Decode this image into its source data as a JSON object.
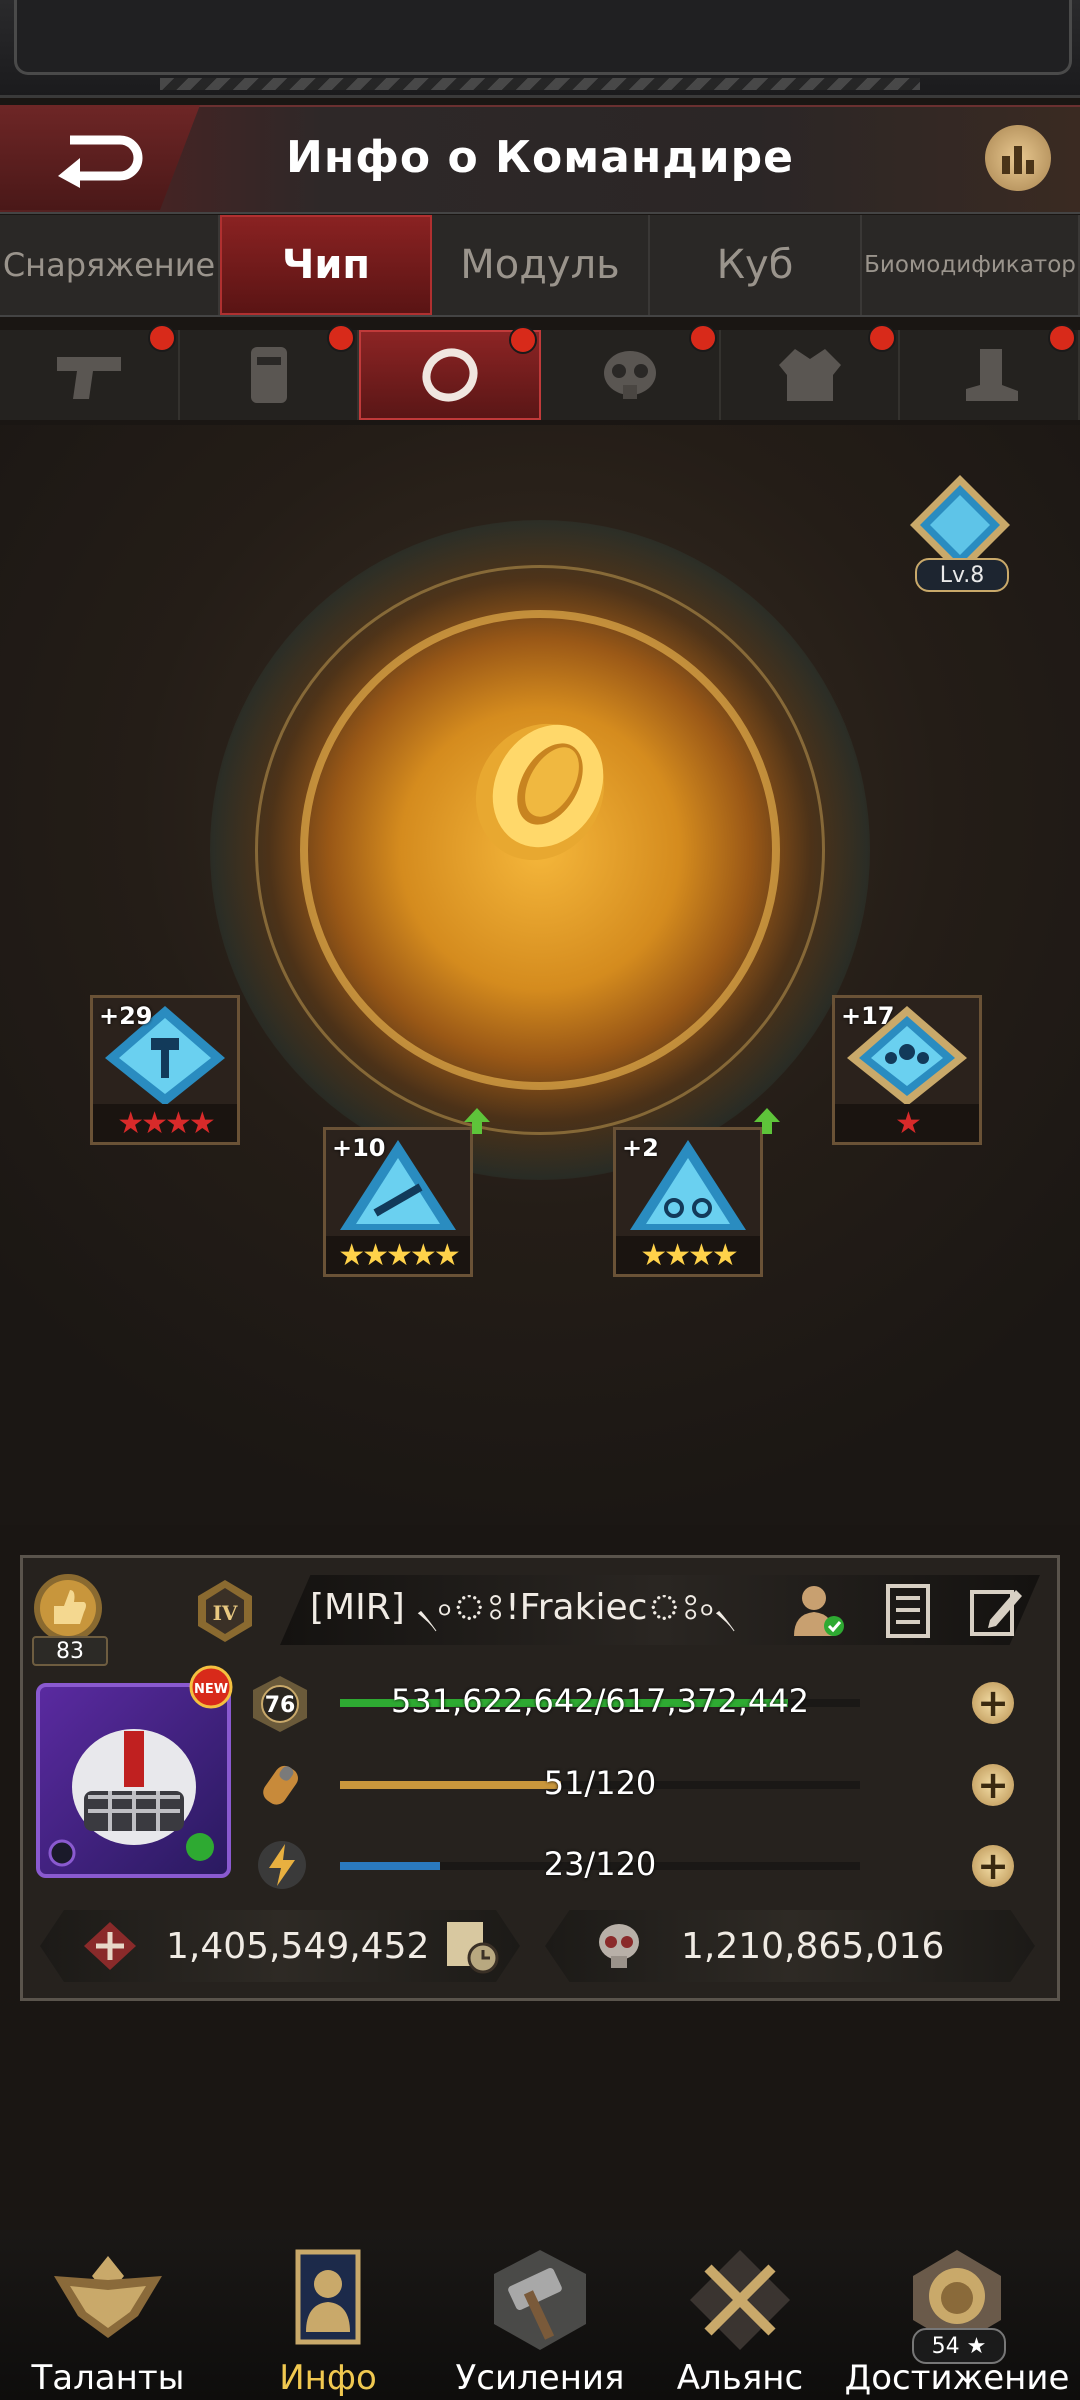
{
  "header": {
    "title": "Инфо о Командире"
  },
  "tabs": [
    {
      "label": "Снаряжение",
      "active": false
    },
    {
      "label": "Чип",
      "active": true
    },
    {
      "label": "Модуль",
      "active": false
    },
    {
      "label": "Куб",
      "active": false
    },
    {
      "label": "Биомодификатор",
      "active": false
    }
  ],
  "slots": [
    {
      "icon": "pistol-icon",
      "active": false
    },
    {
      "icon": "helmet-icon",
      "active": false
    },
    {
      "icon": "ring-icon",
      "active": true
    },
    {
      "icon": "gas-mask-icon",
      "active": false
    },
    {
      "icon": "vest-icon",
      "active": false
    },
    {
      "icon": "boot-icon",
      "active": false
    }
  ],
  "equipment": {
    "level_label": "Lv.8"
  },
  "chips": [
    {
      "level": "+29",
      "stars": "★★★★",
      "star_color": "#d82a2a",
      "icon": "hammer-chip-icon"
    },
    {
      "level": "+10",
      "stars": "★★★★★",
      "star_color": "#ffd24a",
      "icon": "rifle-chip-icon"
    },
    {
      "level": "+2",
      "stars": "★★★★",
      "star_color": "#ffd24a",
      "icon": "motorbike-chip-icon"
    },
    {
      "level": "+17",
      "stars": "★",
      "star_color": "#d82a2a",
      "icon": "group-chip-icon"
    }
  ],
  "profile": {
    "rank": "83",
    "name": "[MIR] ৲৹ঃ!Frakiecঃ৹৲",
    "level": "76",
    "exp": {
      "text": "531,622,642/617,372,442",
      "percent": 86.1,
      "color": "#2eaa32"
    },
    "stamina": {
      "text": "51/120",
      "percent": 42.5,
      "color": "#c8963c"
    },
    "energy": {
      "text": "23/120",
      "percent": 19.2,
      "color": "#2a7ac0"
    },
    "power": "1,405,549,452",
    "kills": "1,210,865,016"
  },
  "bottom_nav": [
    {
      "label": "Таланты"
    },
    {
      "label": "Инфо"
    },
    {
      "label": "Усиления"
    },
    {
      "label": "Альянс"
    },
    {
      "label": "Достижение",
      "badge": "54 ★"
    }
  ]
}
